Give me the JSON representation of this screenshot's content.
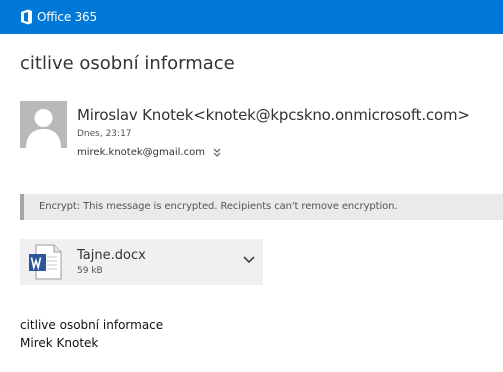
{
  "header": {
    "brand": "Office 365"
  },
  "message": {
    "subject": "citlive osobní informace",
    "sender": "Miroslav Knotek<knotek@kpcskno.onmicrosoft.com>",
    "date": "Dnes, 23:17",
    "to": "mirek.knotek@gmail.com",
    "encryption_notice": "Encrypt: This message is encrypted. Recipients can't remove encryption.",
    "attachment": {
      "name": "Tajne.docx",
      "size": "59 kB",
      "icon": "word-doc-icon"
    },
    "body": [
      "citlive osobní informace",
      "Mirek Knotek"
    ]
  },
  "colors": {
    "accent": "#0078d7",
    "banner_bg": "#eaeaea",
    "banner_border": "#a6a6a6",
    "word_blue": "#2b579a"
  }
}
